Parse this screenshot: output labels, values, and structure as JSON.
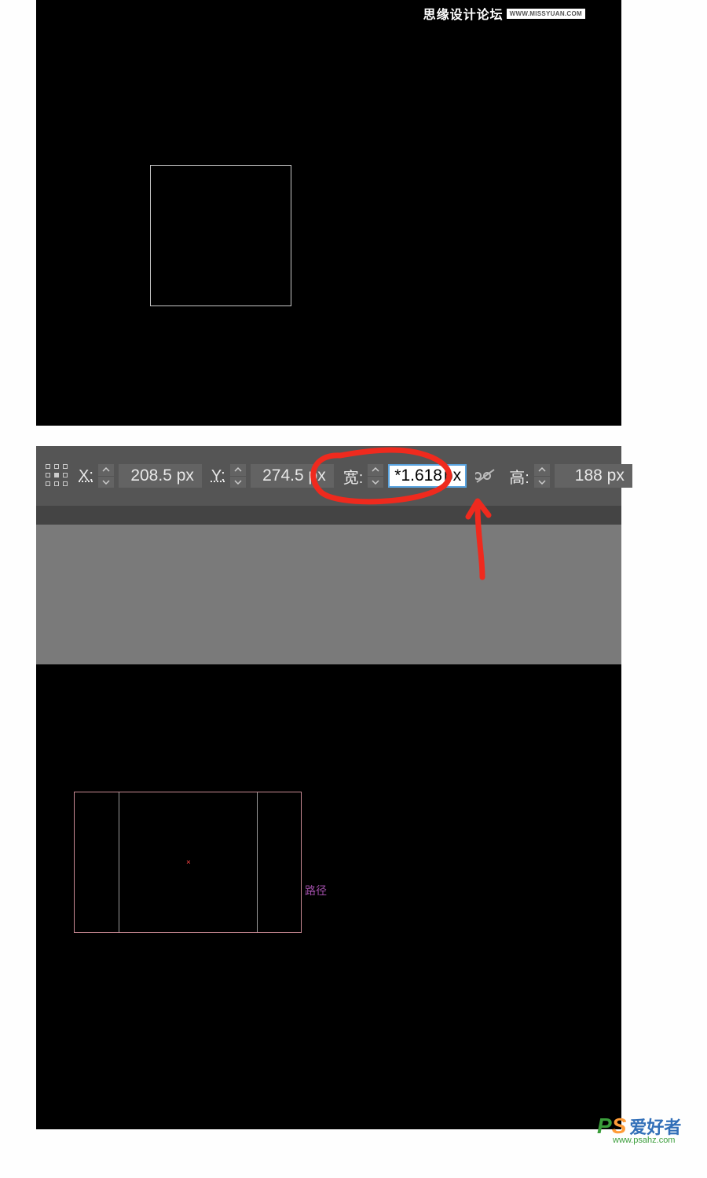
{
  "watermark_top": {
    "text": "思缘设计论坛",
    "url": "WWW.MISSYUAN.COM"
  },
  "toolbar": {
    "x_label": "X:",
    "x_value": "208.5 px",
    "y_label": "Y:",
    "y_value": "274.5 px",
    "w_label": "宽:",
    "w_value_prefix": "*1.618",
    "w_value_suffix": "px",
    "h_label": "高:",
    "h_value": "188 px"
  },
  "path_label": "路径",
  "watermark_bottom": {
    "p": "P",
    "s": "S",
    "cn": "爱好者",
    "url": "www.psahz.com"
  }
}
